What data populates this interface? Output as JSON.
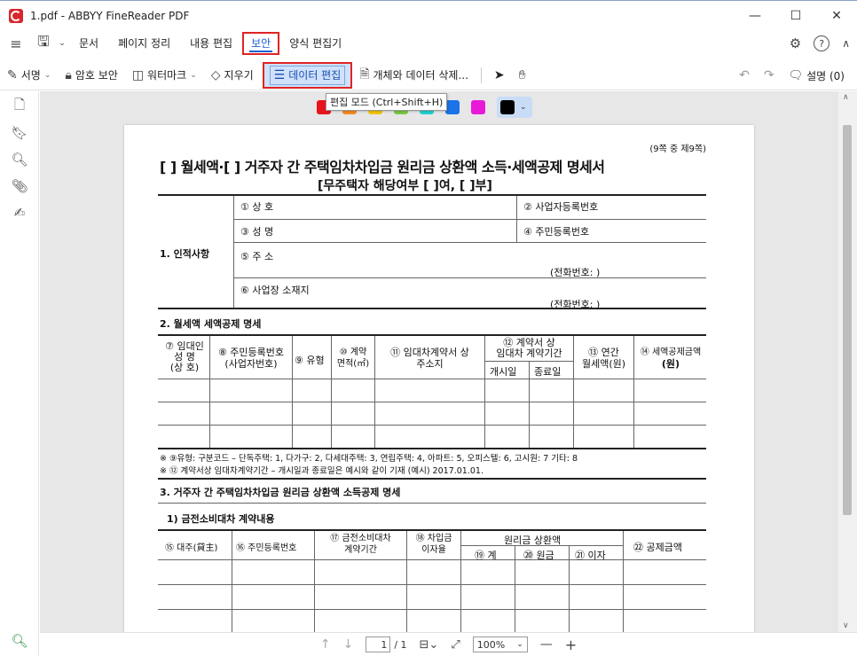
{
  "window": {
    "title": "1.pdf - ABBYY FineReader PDF",
    "minimize": "—",
    "maximize": "☐",
    "close": "✕"
  },
  "menu": {
    "items": [
      "문서",
      "페이지 정리",
      "내용 편집",
      "보안",
      "양식 편집기"
    ],
    "active": "보안"
  },
  "toolbar": {
    "signature": "서명",
    "password": "암호 보안",
    "watermark": "워터마크",
    "erase": "지우기",
    "data_edit": "데이터 편집",
    "delete_objects": "개체와 데이터 삭제...",
    "notes": "설명 (0)"
  },
  "tooltip": "편집 모드 (Ctrl+Shift+H)",
  "colors": {
    "swatches": [
      "#e8141b",
      "#f58a1f",
      "#f2c500",
      "#7ac943",
      "#1fd2d2",
      "#1a73e8",
      "#e81ad8"
    ],
    "selected": "#000000",
    "accent": "#1a5fd1",
    "highlight_border": "#e02424"
  },
  "document": {
    "page_note": "(9쪽 중 제9쪽)",
    "title": "[ ] 월세액·[ ] 거주자 간 주택임차차입금 원리금 상환액 소득·세액공제 명세서",
    "subtitle": "[무주택자 해당여부 [ ]여, [ ]부]",
    "sec1": {
      "label": "1. 인적사항",
      "f1": "① 상 호",
      "f2": "② 사업자등록번호",
      "f3": "③ 성 명",
      "f4": "④ 주민등록번호",
      "f5": "⑤ 주 소",
      "phone1": "(전화번호:                )",
      "f6": "⑥ 사업장 소재지",
      "phone2": "(전화번호:                )"
    },
    "sec2": {
      "label": "2. 월세액 세액공제 명세",
      "h7a": "⑦ 임대인",
      "h7b": "성 명",
      "h7c": "(상 호)",
      "h8a": "⑧ 주민등록번호",
      "h8b": "(사업자번호)",
      "h9": "⑨ 유형",
      "h10a": "⑩ 계약",
      "h10b": "면적(㎡)",
      "h11a": "⑪ 임대차계약서 상",
      "h11b": "주소지",
      "h12a": "⑫ 계약서 상",
      "h12b": "임대차 계약기간",
      "h12c": "개시일",
      "h12d": "종료일",
      "h13a": "⑬ 연간",
      "h13b": "월세액(원)",
      "h14a": "⑭ 세액공제금액",
      "h14b": "(원)"
    },
    "notes": {
      "n1": "※ ⑨유형: 구분코드 – 단독주택: 1, 다가구: 2, 다세대주택: 3, 연립주택: 4, 아파트: 5, 오피스텔: 6, 고시원: 7 기타: 8",
      "n2": "※ ⑫ 계약서상 임대차계약기간 – 개시일과 종료일은 예시와 같이 기재 (예시) 2017.01.01."
    },
    "sec3": {
      "label": "3. 거주자 간 주택임차차입금 원리금 상환액 소득공제 명세",
      "sub": "1) 금전소비대차 계약내용",
      "h15": "⑮ 대주(貸主)",
      "h16": "⑯ 주민등록번호",
      "h17a": "⑰ 금전소비대차",
      "h17b": "계약기간",
      "h18a": "⑱ 차입금",
      "h18b": "이자율",
      "hgroup": "원리금 상환액",
      "h19": "⑲ 계",
      "h20": "⑳ 원금",
      "h21": "㉑ 이자",
      "h22": "㉒ 공제금액"
    }
  },
  "status": {
    "page": "1",
    "total": "/ 1",
    "zoom": "100%"
  }
}
